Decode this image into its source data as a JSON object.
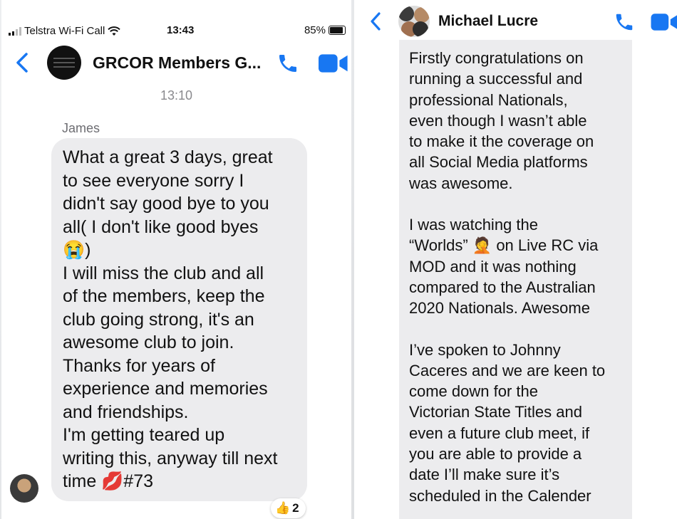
{
  "left": {
    "status": {
      "carrier": "Telstra Wi-Fi Call",
      "time": "13:43",
      "battery": "85%"
    },
    "header": {
      "title": "GRCOR Members G..."
    },
    "timestamp": "13:10",
    "sender": "James",
    "message": "What a great 3 days, great\nto see everyone sorry I\ndidn't say good bye to you\nall( I don't like good byes\n😭)\nI will miss the club and all\nof the members, keep the\nclub going strong, it's an\nawesome club to join.\nThanks for years of\nexperience and memories\nand friendships.\nI'm getting teared up\nwriting this, anyway till next\ntime 💋#73",
    "reaction": {
      "emoji": "👍",
      "count": "2"
    }
  },
  "right": {
    "header": {
      "title": "Michael Lucre"
    },
    "paragraphs": [
      "Firstly congratulations on\nrunning a successful and\nprofessional Nationals,\neven though I wasn’t able\nto make it the coverage on\nall Social Media platforms\nwas awesome.",
      "I was watching the\n“Worlds” 🤦 on Live RC via\nMOD and it was nothing\ncompared to the Australian\n2020 Nationals. Awesome",
      "I’ve spoken to Johnny\nCaceres and we are keen to\ncome down for the\nVictorian State Titles and\neven a future club meet, if\nyou are able to provide a\ndate I’ll make sure it’s\nscheduled in the Calender"
    ]
  },
  "colors": {
    "accent": "#1877f2",
    "bubble": "#ececee",
    "meta_text": "#8a8a8e"
  },
  "icons": [
    "back-chevron-icon",
    "phone-icon",
    "video-icon",
    "signal-icon",
    "wifi-icon",
    "battery-icon",
    "thumbs-up-icon"
  ]
}
